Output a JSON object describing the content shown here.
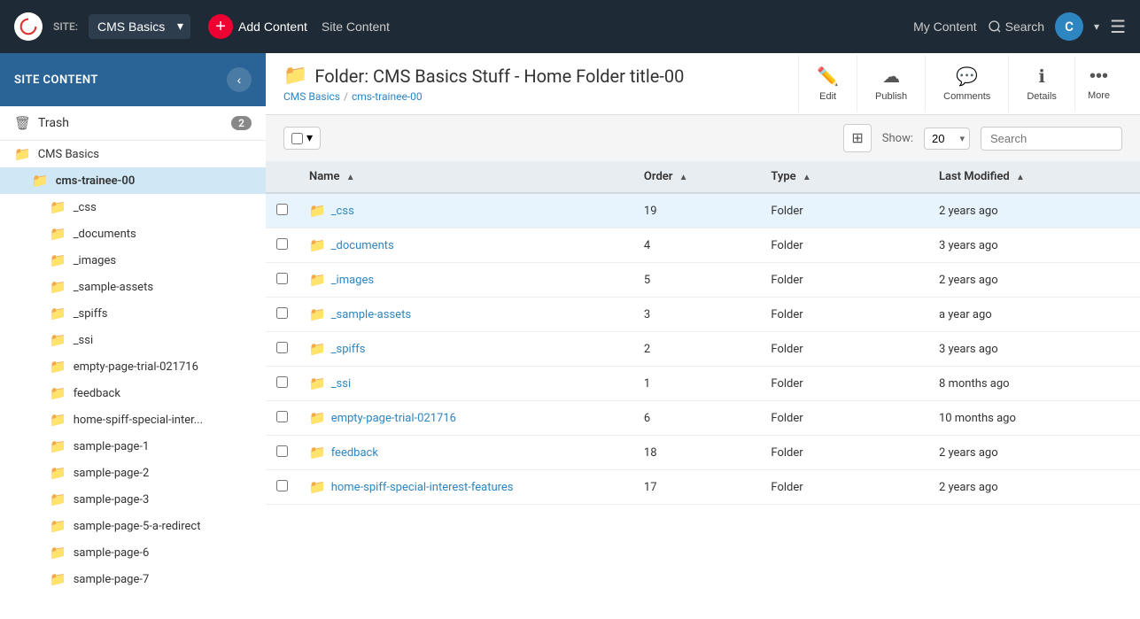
{
  "topnav": {
    "logo_text": "C",
    "site_label": "SITE:",
    "site_name": "CMS Basics",
    "add_content_label": "Add Content",
    "site_content_label": "Site Content",
    "my_content_label": "My Content",
    "search_label": "Search",
    "user_initial": "C"
  },
  "sidebar": {
    "title": "SITE CONTENT",
    "trash_label": "Trash",
    "trash_count": "2",
    "tree_items": [
      {
        "label": "CMS Basics",
        "level": 1,
        "active": false
      },
      {
        "label": "cms-trainee-00",
        "level": 2,
        "active": true
      },
      {
        "label": "_css",
        "level": 3,
        "active": false
      },
      {
        "label": "_documents",
        "level": 3,
        "active": false
      },
      {
        "label": "_images",
        "level": 3,
        "active": false
      },
      {
        "label": "_sample-assets",
        "level": 3,
        "active": false
      },
      {
        "label": "_spiffs",
        "level": 3,
        "active": false
      },
      {
        "label": "_ssi",
        "level": 3,
        "active": false
      },
      {
        "label": "empty-page-trial-021716",
        "level": 3,
        "active": false
      },
      {
        "label": "feedback",
        "level": 3,
        "active": false
      },
      {
        "label": "home-spiff-special-inter...",
        "level": 3,
        "active": false
      },
      {
        "label": "sample-page-1",
        "level": 3,
        "active": false
      },
      {
        "label": "sample-page-2",
        "level": 3,
        "active": false
      },
      {
        "label": "sample-page-3",
        "level": 3,
        "active": false
      },
      {
        "label": "sample-page-5-a-redirect",
        "level": 3,
        "active": false
      },
      {
        "label": "sample-page-6",
        "level": 3,
        "active": false
      },
      {
        "label": "sample-page-7",
        "level": 3,
        "active": false
      }
    ]
  },
  "content_header": {
    "title": "Folder: CMS Basics Stuff - Home Folder title-00",
    "breadcrumb_site": "CMS Basics",
    "breadcrumb_folder": "cms-trainee-00",
    "actions": {
      "edit": "Edit",
      "publish": "Publish",
      "comments": "Comments",
      "details": "Details",
      "more": "More"
    }
  },
  "toolbar": {
    "show_label": "Show:",
    "show_value": "20",
    "search_placeholder": "Search"
  },
  "table": {
    "columns": [
      {
        "key": "name",
        "label": "Name",
        "sortable": true,
        "sort_dir": "asc"
      },
      {
        "key": "order",
        "label": "Order",
        "sortable": true,
        "sort_dir": "asc"
      },
      {
        "key": "type",
        "label": "Type",
        "sortable": true,
        "sort_dir": "asc"
      },
      {
        "key": "last_modified",
        "label": "Last Modified",
        "sortable": true,
        "sort_dir": "asc"
      }
    ],
    "rows": [
      {
        "name": "_css",
        "order": "19",
        "type": "Folder",
        "last_modified": "2 years ago",
        "highlighted": true
      },
      {
        "name": "_documents",
        "order": "4",
        "type": "Folder",
        "last_modified": "3 years ago",
        "highlighted": false
      },
      {
        "name": "_images",
        "order": "5",
        "type": "Folder",
        "last_modified": "2 years ago",
        "highlighted": false
      },
      {
        "name": "_sample-assets",
        "order": "3",
        "type": "Folder",
        "last_modified": "a year ago",
        "highlighted": false
      },
      {
        "name": "_spiffs",
        "order": "2",
        "type": "Folder",
        "last_modified": "3 years ago",
        "highlighted": false
      },
      {
        "name": "_ssi",
        "order": "1",
        "type": "Folder",
        "last_modified": "8 months ago",
        "highlighted": false
      },
      {
        "name": "empty-page-trial-021716",
        "order": "6",
        "type": "Folder",
        "last_modified": "10 months ago",
        "highlighted": false
      },
      {
        "name": "feedback",
        "order": "18",
        "type": "Folder",
        "last_modified": "2 years ago",
        "highlighted": false
      },
      {
        "name": "home-spiff-special-interest-features",
        "order": "17",
        "type": "Folder",
        "last_modified": "2 years ago",
        "highlighted": false
      }
    ]
  }
}
